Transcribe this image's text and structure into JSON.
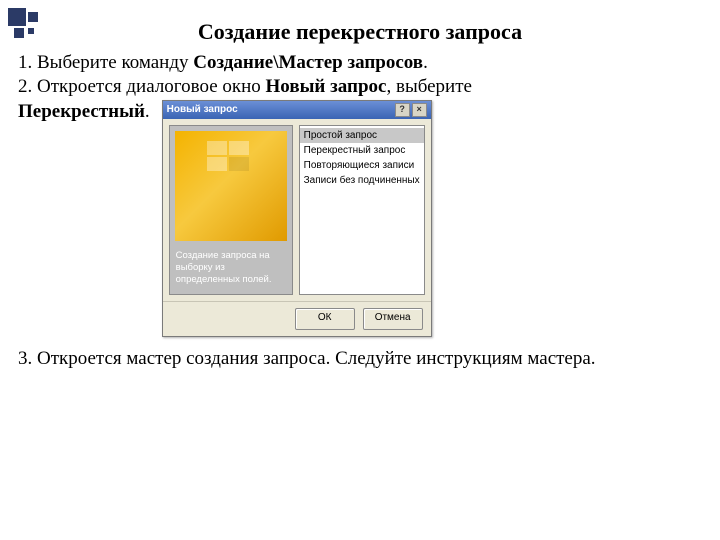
{
  "title": "Создание перекрестного запроса",
  "step1_pre": "1. Выберите команду ",
  "step1_bold": "Создание\\Мастер запросов",
  "step1_post": ".",
  "step2_line1": "2. Откроется  диалоговое окно ",
  "step2_bold1": "Новый запрос",
  "step2_mid": ", выберите",
  "step2_bold2": "Перекрестный",
  "step2_post": ".",
  "dialog": {
    "title": "Новый запрос",
    "help": "?",
    "close": "×",
    "desc_l1": "Создание запроса на выборку из",
    "desc_l2": "определенных полей.",
    "options": [
      "Простой запрос",
      "Перекрестный запрос",
      "Повторяющиеся записи",
      "Записи без подчиненных"
    ],
    "ok": "ОК",
    "cancel": "Отмена"
  },
  "step3": "3. Откроется мастер создания запроса. Следуйте инструкциям мастера."
}
